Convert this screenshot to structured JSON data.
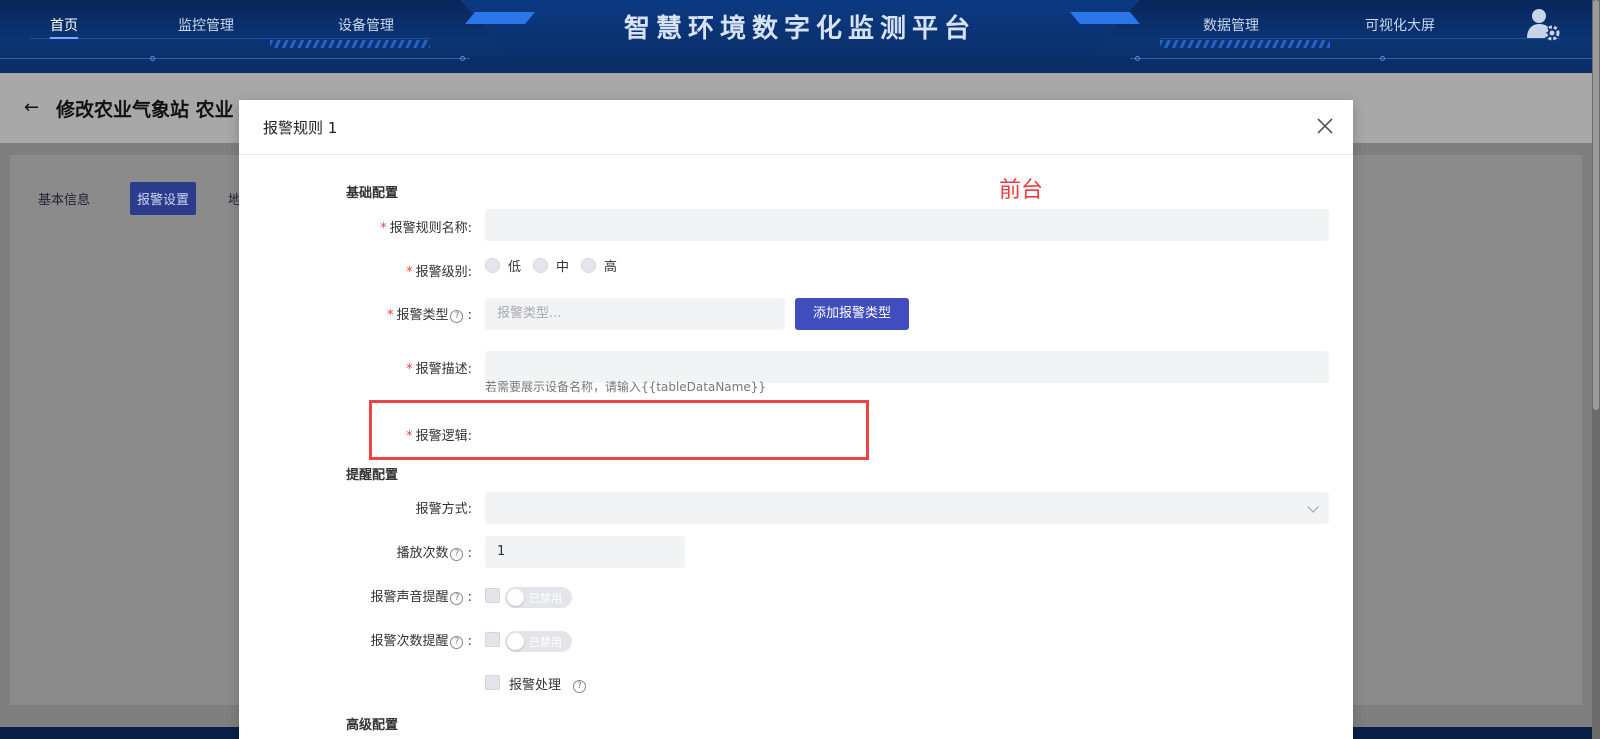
{
  "header": {
    "title": "智慧环境数字化监测平台",
    "nav_left": [
      "首页",
      "监控管理",
      "设备管理"
    ],
    "nav_right": [
      "数据管理",
      "可视化大屏"
    ],
    "active_nav": "首页",
    "user_icon": "user-gear-icon"
  },
  "page": {
    "back_icon": "arrow-left-icon",
    "title": "修改农业气象站  农业",
    "tabs": [
      "基本信息",
      "报警设置",
      "地"
    ],
    "active_tab": "报警设置"
  },
  "modal": {
    "title": "报警规则 1",
    "close_icon": "close-icon",
    "annotation": "前台",
    "sections": {
      "basic": "基础配置",
      "reminder": "提醒配置",
      "advanced": "高级配置"
    },
    "fields": {
      "rule_name": {
        "label": "报警规则名称",
        "value": ""
      },
      "level": {
        "label": "报警级别",
        "options": [
          "低",
          "中",
          "高"
        ]
      },
      "type": {
        "label": "报警类型",
        "placeholder": "报警类型...",
        "add_button": "添加报警类型"
      },
      "description": {
        "label": "报警描述",
        "value": "",
        "hint": "若需要展示设备名称，请输入{{tableDataName}}"
      },
      "logic": {
        "label": "报警逻辑"
      },
      "method": {
        "label": "报警方式",
        "value": ""
      },
      "play_count": {
        "label": "播放次数",
        "value": "1"
      },
      "sound_reminder": {
        "label": "报警声音提醒",
        "switch_text": "已禁用"
      },
      "count_reminder": {
        "label": "报警次数提醒",
        "switch_text": "已禁用"
      },
      "handle": {
        "label": "报警处理"
      }
    },
    "colors": {
      "primary": "#3f4dbd",
      "required": "#f04040",
      "annotation": "#ee3b3b"
    }
  }
}
